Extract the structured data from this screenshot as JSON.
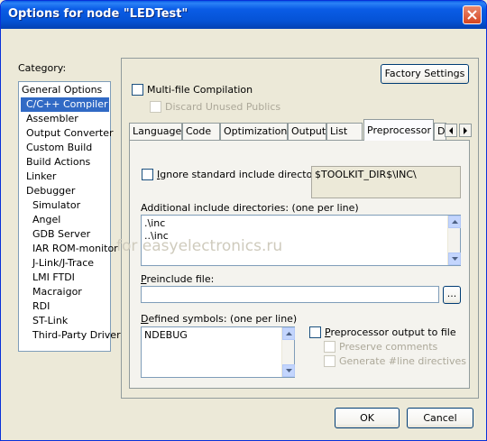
{
  "window": {
    "title": "Options for node \"LEDTest\""
  },
  "category": {
    "label": "Category:",
    "items": [
      {
        "label": "General Options",
        "indent": false,
        "selected": false
      },
      {
        "label": "C/C++ Compiler",
        "indent": true,
        "selected": true
      },
      {
        "label": "Assembler",
        "indent": true,
        "selected": false
      },
      {
        "label": "Output Converter",
        "indent": true,
        "selected": false
      },
      {
        "label": "Custom Build",
        "indent": true,
        "selected": false
      },
      {
        "label": "Build Actions",
        "indent": true,
        "selected": false
      },
      {
        "label": "Linker",
        "indent": true,
        "selected": false
      },
      {
        "label": "Debugger",
        "indent": true,
        "selected": false
      },
      {
        "label": "Simulator",
        "indent": true,
        "selected": false
      },
      {
        "label": "Angel",
        "indent": true,
        "selected": false
      },
      {
        "label": "GDB Server",
        "indent": true,
        "selected": false
      },
      {
        "label": "IAR ROM-monitor",
        "indent": true,
        "selected": false
      },
      {
        "label": "J-Link/J-Trace",
        "indent": true,
        "selected": false
      },
      {
        "label": "LMI FTDI",
        "indent": true,
        "selected": false
      },
      {
        "label": "Macraigor",
        "indent": true,
        "selected": false
      },
      {
        "label": "RDI",
        "indent": true,
        "selected": false
      },
      {
        "label": "ST-Link",
        "indent": true,
        "selected": false
      },
      {
        "label": "Third-Party Driver",
        "indent": true,
        "selected": false
      }
    ]
  },
  "panel": {
    "factory_settings": "Factory Settings",
    "multifile": {
      "label": "Multi-file Compilation",
      "checked": false
    },
    "discard_unused": {
      "label": "Discard Unused Publics",
      "checked": false,
      "disabled": true
    },
    "tabs": [
      "Language",
      "Code",
      "Optimizations",
      "Output",
      "List",
      "Preprocessor",
      "D"
    ],
    "active_tab": "Preprocessor"
  },
  "preprocessor": {
    "ignore_std_label": "Ignore standard include directories",
    "ignore_std_checked": false,
    "toolkit_dir": "$TOOLKIT_DIR$\\INC\\",
    "additional_include_label": "Additional include directories: (one per line)",
    "additional_include_lines": [
      ".\\inc",
      "..\\inc"
    ],
    "preinclude_label": "Preinclude file:",
    "preinclude_value": "",
    "browse_label": "...",
    "defined_symbols_label": "Defined symbols: (one per line)",
    "defined_symbols": [
      "NDEBUG"
    ],
    "pp_output": {
      "label": "Preprocessor output to file",
      "checked": false
    },
    "preserve_comments": {
      "label": "Preserve comments",
      "checked": false,
      "disabled": true
    },
    "generate_line": {
      "label": "Generate #line directives",
      "checked": false,
      "disabled": true
    }
  },
  "watermark": "for easyelectronics.ru",
  "footer": {
    "ok": "OK",
    "cancel": "Cancel"
  }
}
